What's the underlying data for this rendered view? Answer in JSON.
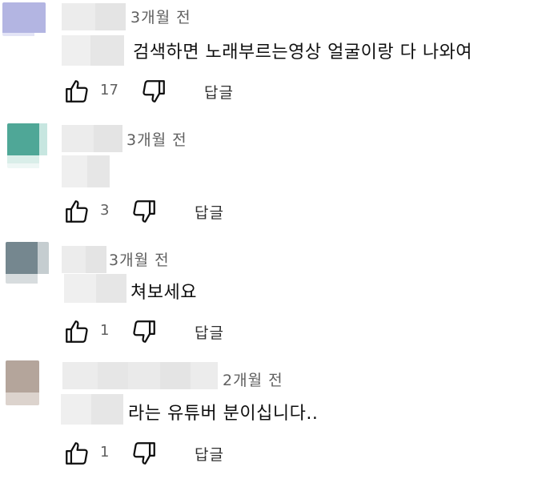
{
  "comments": [
    {
      "time": "3개월 전",
      "text": "검색하면 노래부르는영상 얼굴이랑 다 나와여",
      "likes": "17",
      "reply_label": "답글",
      "avatar_color": "#b3b5e2"
    },
    {
      "time": "3개월 전",
      "text": "",
      "likes": "3",
      "reply_label": "답글",
      "avatar_color": "#4fa797"
    },
    {
      "time": "3개월 전",
      "text": "쳐보세요",
      "likes": "1",
      "reply_label": "답글",
      "avatar_color": "#75878f"
    },
    {
      "time": "2개월 전",
      "text": "라는 유튜버 분이십니다..",
      "likes": "1",
      "reply_label": "답글",
      "avatar_color": "#b4a59b"
    }
  ],
  "icons": {
    "like": "thumbs-up-icon",
    "dislike": "thumbs-down-icon"
  }
}
